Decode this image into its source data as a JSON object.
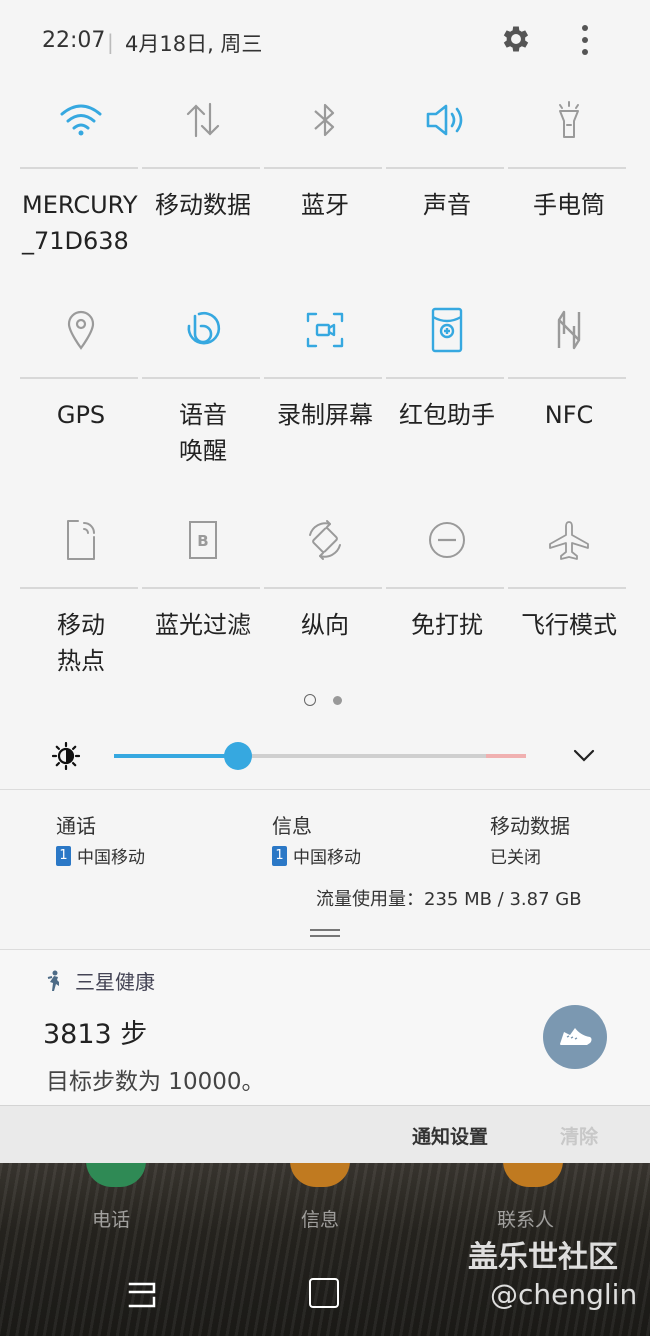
{
  "status": {
    "time": "22:07",
    "separator": "|",
    "date": "4月18日, 周三",
    "icons": [
      "gear-icon",
      "more-vert-icon"
    ]
  },
  "colors": {
    "accent": "#36a8e0",
    "inactive_icon": "#9a9a9a",
    "slider_track": "#cfcfcf",
    "badge_blue": "#2b78c6",
    "shoe_button": "#7b98b1"
  },
  "tiles": [
    {
      "label": "MERCURY\n_71D638",
      "icon": "wifi-icon",
      "active": true
    },
    {
      "label": "移动数据",
      "icon": "mobile-data-icon",
      "active": false
    },
    {
      "label": "蓝牙",
      "icon": "bluetooth-icon",
      "active": false
    },
    {
      "label": "声音",
      "icon": "sound-icon",
      "active": true
    },
    {
      "label": "手电筒",
      "icon": "flashlight-icon",
      "active": false
    },
    {
      "label": "GPS",
      "icon": "location-icon",
      "active": false
    },
    {
      "label": "语音\n唤醒",
      "icon": "bixby-voice-icon",
      "active": true
    },
    {
      "label": "录制屏幕",
      "icon": "screen-record-icon",
      "active": true
    },
    {
      "label": "红包助手",
      "icon": "red-envelope-icon",
      "active": true
    },
    {
      "label": "NFC",
      "icon": "nfc-icon",
      "active": false
    },
    {
      "label": "移动\n热点",
      "icon": "hotspot-icon",
      "active": false
    },
    {
      "label": "蓝光过滤",
      "icon": "blue-light-filter-icon",
      "active": false
    },
    {
      "label": "纵向",
      "icon": "rotation-icon",
      "active": false
    },
    {
      "label": "免打扰",
      "icon": "do-not-disturb-icon",
      "active": false
    },
    {
      "label": "飞行模式",
      "icon": "airplane-icon",
      "active": false
    }
  ],
  "page_indicator": {
    "current": 1,
    "total": 2
  },
  "brightness": {
    "level": 0.3
  },
  "sim": {
    "call": {
      "title": "通话",
      "badge": "1",
      "carrier": "中国移动"
    },
    "message": {
      "title": "信息",
      "badge": "1",
      "carrier": "中国移动"
    },
    "data": {
      "title": "移动数据",
      "status": "已关闭"
    },
    "usage": "流量使用量：235 MB / 3.87 GB"
  },
  "notification": {
    "app": "三星健康",
    "steps": "3813 步",
    "goal": "目标步数为 10000。"
  },
  "footer": {
    "settings": "通知设置",
    "clear": "清除"
  },
  "home": {
    "apps": [
      "电话",
      "信息",
      "联系人"
    ]
  },
  "watermark": {
    "line1": "盖乐世社区",
    "line2": "@chenglin"
  }
}
